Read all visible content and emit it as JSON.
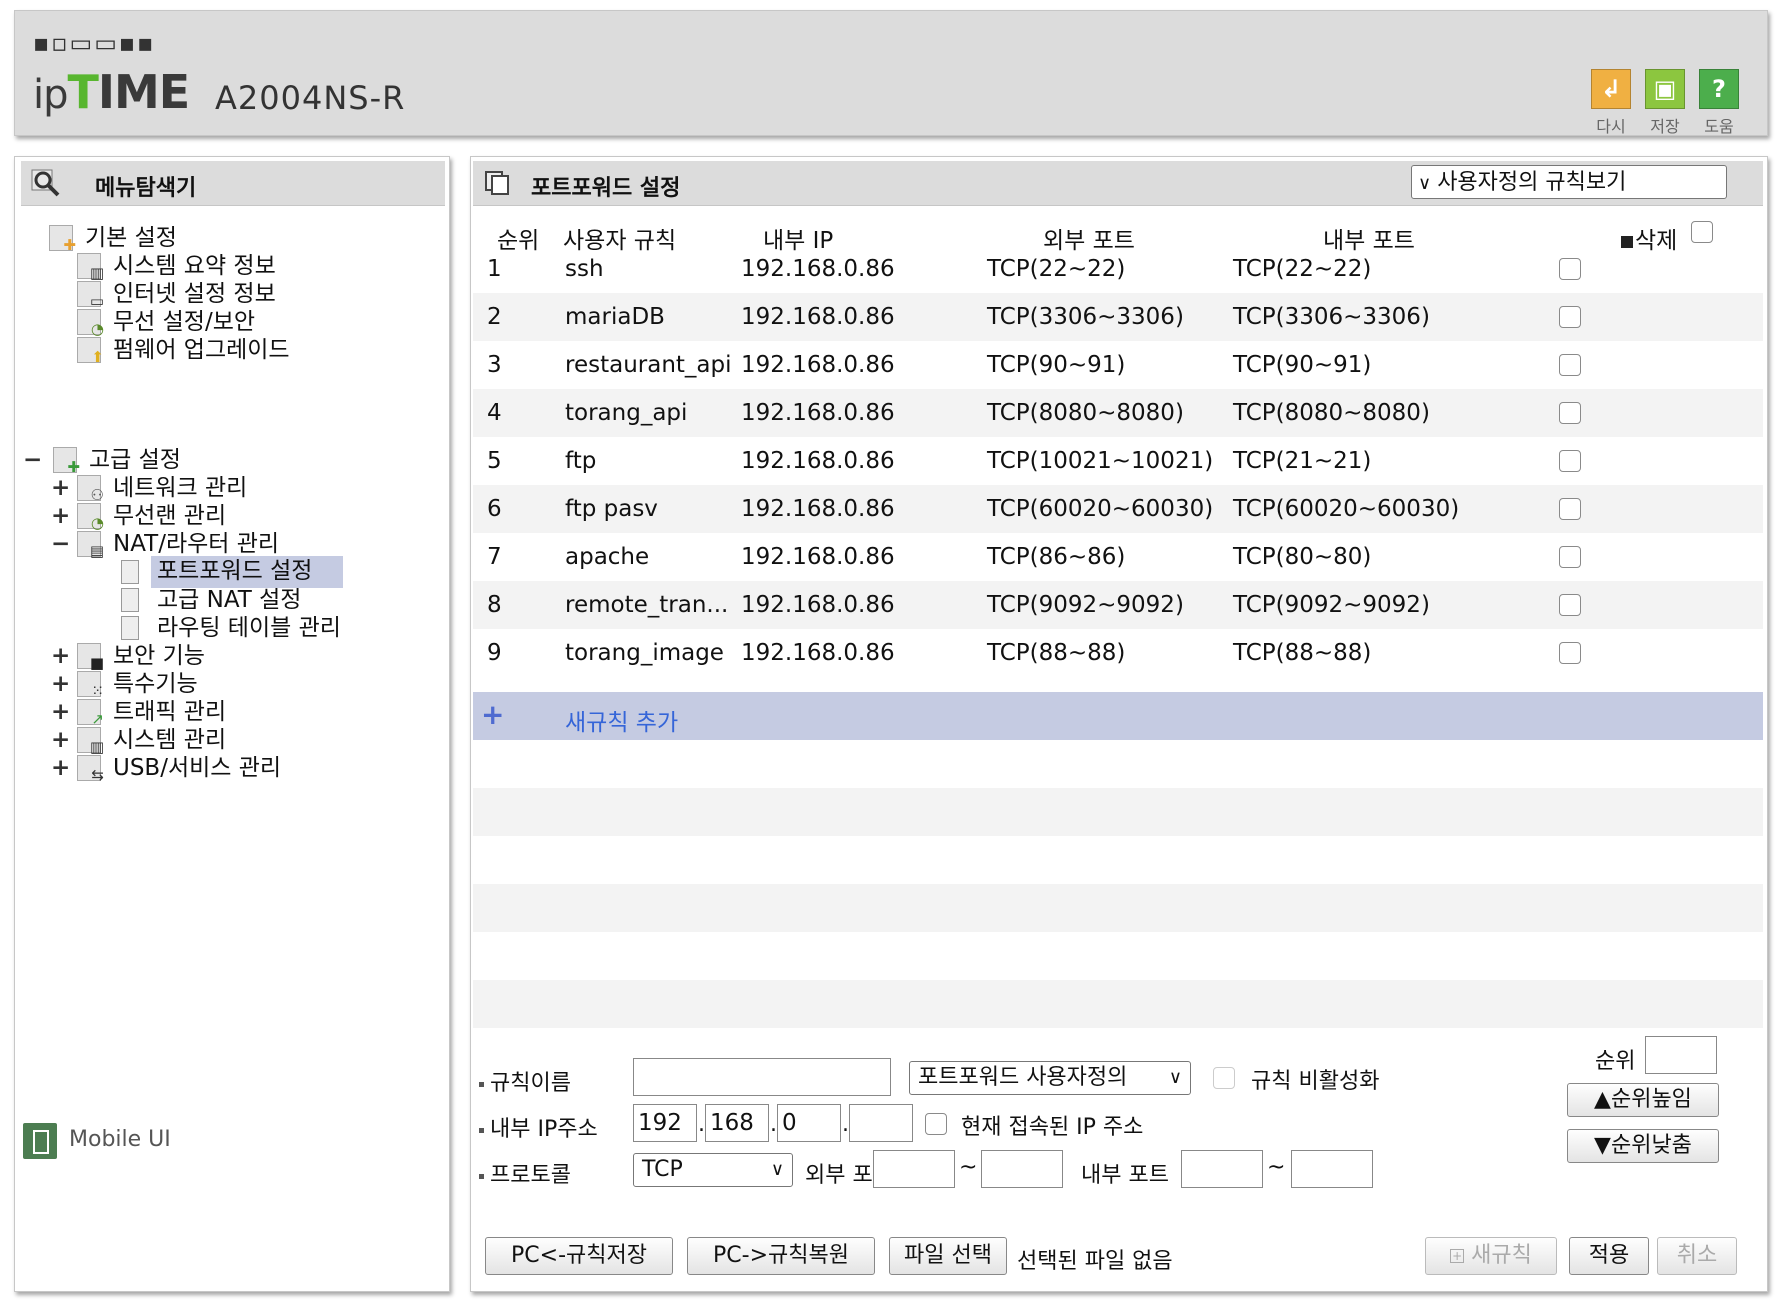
{
  "header": {
    "brand_mark": "▪▫▭▭▪▪",
    "logo_ip": "ip",
    "logo_t": "T",
    "logo_rest": "IME",
    "model": "A2004NS-R",
    "tools": [
      {
        "label": "다시",
        "icon": "undo-icon",
        "color": "#f0b042",
        "glyph": "↲"
      },
      {
        "label": "저장",
        "icon": "save-icon",
        "color": "#8cc63f",
        "glyph": "▣"
      },
      {
        "label": "도움",
        "icon": "help-icon",
        "color": "#4cae4c",
        "glyph": "?"
      }
    ]
  },
  "sidebar": {
    "title": "메뉴탐색기",
    "basic": {
      "label": "기본 설정",
      "items": [
        "시스템 요약 정보",
        "인터넷 설정 정보",
        "무선 설정/보안",
        "펌웨어 업그레이드"
      ]
    },
    "advanced": {
      "expander": "−",
      "label": "고급 설정",
      "items": [
        {
          "exp": "+",
          "label": "네트워크 관리"
        },
        {
          "exp": "+",
          "label": "무선랜 관리"
        },
        {
          "exp": "−",
          "label": "NAT/라우터 관리"
        }
      ],
      "nat_children": [
        "포트포워드 설정",
        "고급 NAT 설정",
        "라우팅 테이블 관리"
      ],
      "more_items": [
        {
          "exp": "+",
          "label": "보안 기능"
        },
        {
          "exp": "+",
          "label": "특수기능"
        },
        {
          "exp": "+",
          "label": "트래픽 관리"
        },
        {
          "exp": "+",
          "label": "시스템 관리"
        },
        {
          "exp": "+",
          "label": "USB/서비스 관리"
        }
      ]
    },
    "mobile_ui": "Mobile UI"
  },
  "main": {
    "title": "포트포워드 설정",
    "view_select": "사용자정의 규칙보기",
    "columns": {
      "order": "순위",
      "rule": "사용자 규칙",
      "ip": "내부 IP",
      "ext": "외부 포트",
      "int": "내부 포트",
      "del": "삭제"
    },
    "rules": [
      {
        "n": "1",
        "name": "ssh",
        "ip": "192.168.0.86",
        "ext": "TCP(22~22)",
        "int": "TCP(22~22)"
      },
      {
        "n": "2",
        "name": "mariaDB",
        "ip": "192.168.0.86",
        "ext": "TCP(3306~3306)",
        "int": "TCP(3306~3306)"
      },
      {
        "n": "3",
        "name": "restaurant_api",
        "ip": "192.168.0.86",
        "ext": "TCP(90~91)",
        "int": "TCP(90~91)"
      },
      {
        "n": "4",
        "name": "torang_api",
        "ip": "192.168.0.86",
        "ext": "TCP(8080~8080)",
        "int": "TCP(8080~8080)"
      },
      {
        "n": "5",
        "name": "ftp",
        "ip": "192.168.0.86",
        "ext": "TCP(10021~10021)",
        "int": "TCP(21~21)"
      },
      {
        "n": "6",
        "name": "ftp pasv",
        "ip": "192.168.0.86",
        "ext": "TCP(60020~60030)",
        "int": "TCP(60020~60030)"
      },
      {
        "n": "7",
        "name": "apache",
        "ip": "192.168.0.86",
        "ext": "TCP(86~86)",
        "int": "TCP(80~80)"
      },
      {
        "n": "8",
        "name": "remote_tran...",
        "ip": "192.168.0.86",
        "ext": "TCP(9092~9092)",
        "int": "TCP(9092~9092)"
      },
      {
        "n": "9",
        "name": "torang_image",
        "ip": "192.168.0.86",
        "ext": "TCP(88~88)",
        "int": "TCP(88~88)"
      }
    ],
    "add_rule": "새규칙 추가"
  },
  "form": {
    "rule_name_label": "규칙이름",
    "rule_name_value": "",
    "type_select": "포트포워드 사용자정의",
    "disable_label": "규칙 비활성화",
    "ip_label": "내부 IP주소",
    "ip": [
      "192",
      "168",
      "0",
      ""
    ],
    "current_ip_label": "현재 접속된 IP 주소",
    "protocol_label": "프로토콜",
    "protocol": "TCP",
    "ext_port_label": "외부 포트",
    "int_port_label": "내부 포트",
    "tilde": "~",
    "order_label": "순위",
    "up_btn": "▲순위높임",
    "down_btn": "▼순위낮춤"
  },
  "buttons": {
    "save_pc": "PC<-규칙저장",
    "restore_pc": "PC->규칙복원",
    "file_select": "파일 선택",
    "no_file": "선택된 파일 없음",
    "new_rule": "새규칙",
    "apply": "적용",
    "cancel": "취소"
  }
}
